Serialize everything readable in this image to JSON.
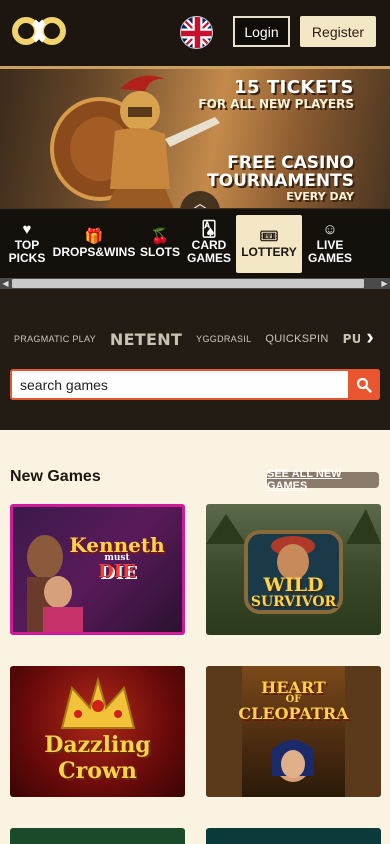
{
  "header": {
    "login_label": "Login",
    "register_label": "Register",
    "language_icon": "uk-flag-icon"
  },
  "banner": {
    "line1": "15 TICKETS",
    "line2": "FOR ALL NEW PLAYERS",
    "line3": "FREE CASINO",
    "line4": "TOURNAMENTS",
    "line5": "EVERY DAY"
  },
  "categories": [
    {
      "label_1": "TOP",
      "label_2": "PICKS",
      "icon": "heart-icon"
    },
    {
      "label_1": "DROPS&WINS",
      "label_2": "",
      "icon": "gift-icon"
    },
    {
      "label_1": "SLOTS",
      "label_2": "",
      "icon": "cherry-icon"
    },
    {
      "label_1": "CARD",
      "label_2": "GAMES",
      "icon": "cards-icon"
    },
    {
      "label_1": "LOTTERY",
      "label_2": "",
      "icon": "ticket-icon"
    },
    {
      "label_1": "LIVE",
      "label_2": "GAMES",
      "icon": "dealer-icon"
    }
  ],
  "providers": [
    "PRAGMATIC PLAY",
    "NETENT",
    "YGGDRASIL",
    "QUICKSPIN",
    "PUSH"
  ],
  "search": {
    "placeholder": "search games"
  },
  "new_games": {
    "title": "New Games",
    "see_all_label": "SEE ALL NEW GAMES",
    "games": [
      {
        "title": "Kenneth",
        "subtitle_small": "must",
        "subtitle": "DIE"
      },
      {
        "title": "WILD",
        "subtitle_small": "",
        "subtitle": "SURVIVOR"
      },
      {
        "title": "Dazzling",
        "subtitle_small": "",
        "subtitle": "Crown"
      },
      {
        "title": "HEART",
        "subtitle_small": "OF",
        "subtitle": "CLEOPATRA"
      }
    ]
  },
  "colors": {
    "accent": "#e8552e",
    "cream": "#f4e7c6",
    "dark": "#1c1510"
  }
}
